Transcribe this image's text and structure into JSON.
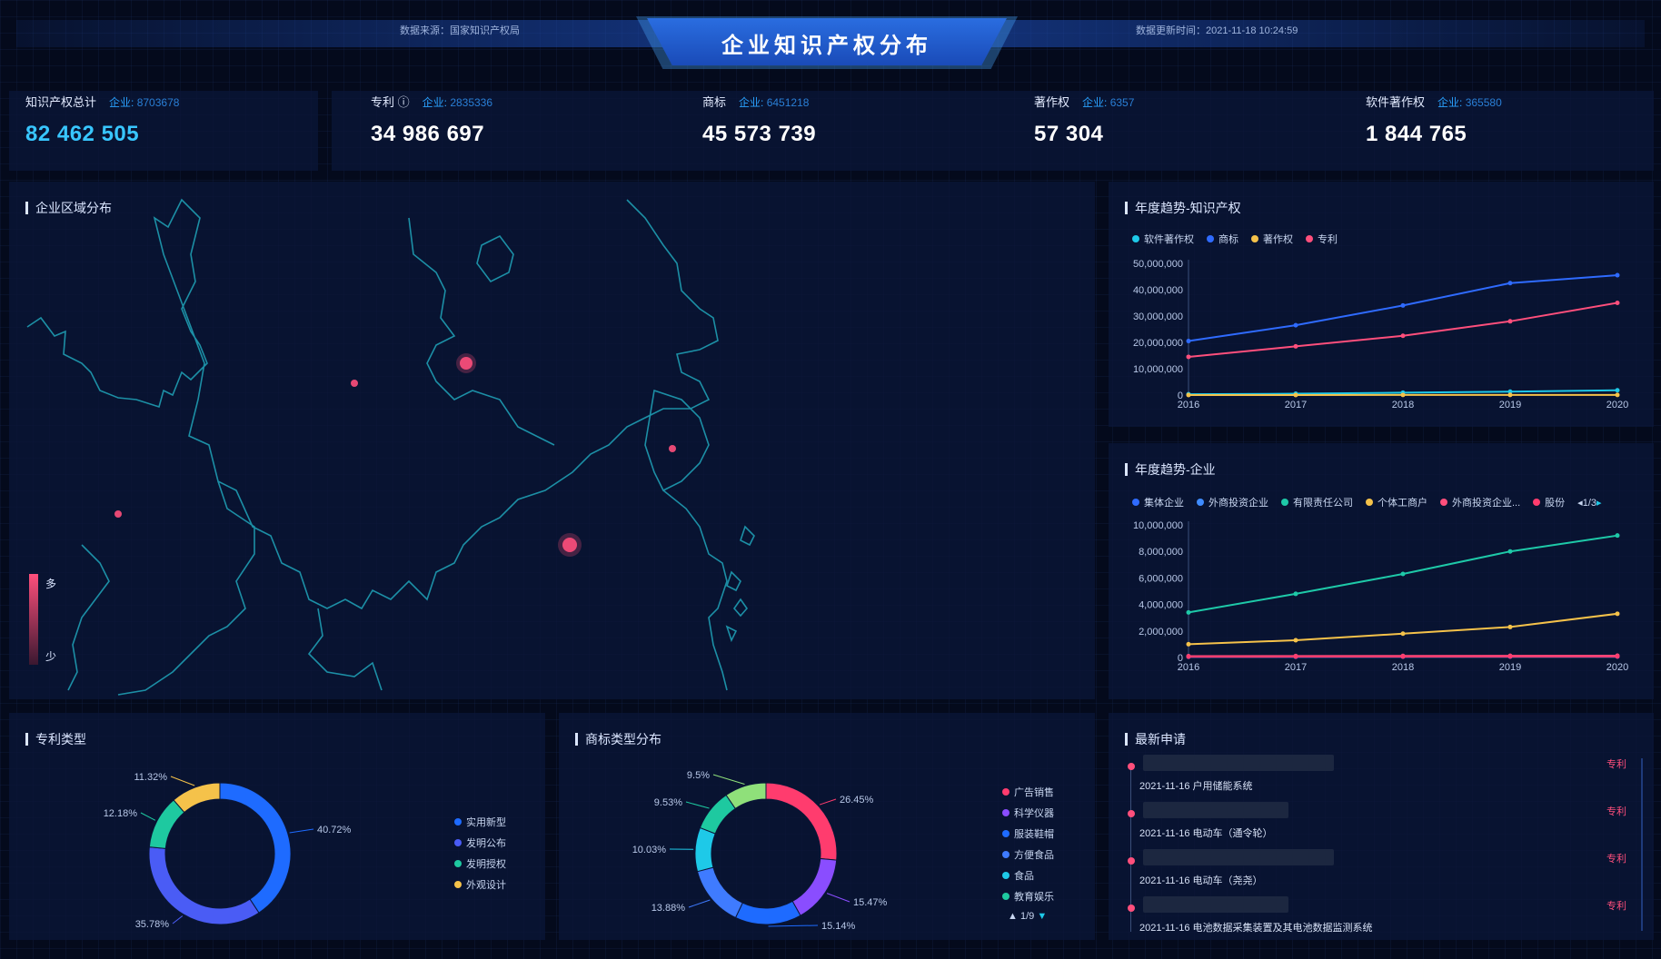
{
  "header": {
    "title": "企业知识产权分布",
    "source": "数据来源：国家知识产权局",
    "update_time": "数据更新时间：2021-11-18 10:24:59"
  },
  "stats": [
    {
      "label": "知识产权总计",
      "company_label": "企业:",
      "company_value": "8703678",
      "value": "82 462 505",
      "color": "#38c6ff"
    },
    {
      "label": "专利 ⓘ",
      "company_label": "企业:",
      "company_value": "2835336",
      "value": "34 986 697",
      "color": "#ffffff"
    },
    {
      "label": "商标",
      "company_label": "企业:",
      "company_value": "6451218",
      "value": "45 573 739",
      "color": "#ffffff"
    },
    {
      "label": "著作权",
      "company_label": "企业:",
      "company_value": "6357",
      "value": "57 304",
      "color": "#ffffff"
    },
    {
      "label": "软件著作权",
      "company_label": "企业:",
      "company_value": "365580",
      "value": "1 844 765",
      "color": "#ffffff"
    }
  ],
  "map_panel": {
    "title": "企业区域分布",
    "scale_high": "多",
    "scale_low": "少"
  },
  "chart_data": [
    {
      "type": "line",
      "title": "年度趋势-知识产权",
      "x": [
        "2016",
        "2017",
        "2018",
        "2019",
        "2020"
      ],
      "ylim": [
        0,
        50000000
      ],
      "yticks": [
        "0",
        "10,000,000",
        "20,000,000",
        "30,000,000",
        "40,000,000",
        "50,000,000"
      ],
      "series": [
        {
          "name": "软件著作权",
          "color": "#1ec9e8",
          "values": [
            300000,
            500000,
            900000,
            1300000,
            1800000
          ]
        },
        {
          "name": "商标",
          "color": "#2f6bff",
          "values": [
            20500000,
            26500000,
            34000000,
            42500000,
            45500000
          ]
        },
        {
          "name": "著作权",
          "color": "#f5c24a",
          "values": [
            10000,
            20000,
            30000,
            45000,
            57000
          ]
        },
        {
          "name": "专利",
          "color": "#ff4f7c",
          "values": [
            14500000,
            18500000,
            22500000,
            28000000,
            35000000
          ]
        }
      ]
    },
    {
      "type": "line",
      "title": "年度趋势-企业",
      "x": [
        "2016",
        "2017",
        "2018",
        "2019",
        "2020"
      ],
      "ylim": [
        0,
        10000000
      ],
      "yticks": [
        "0",
        "2,000,000",
        "4,000,000",
        "6,000,000",
        "8,000,000",
        "10,000,000"
      ],
      "pager": "1/3",
      "series": [
        {
          "name": "集体企业",
          "color": "#2f6bff",
          "values": [
            50000,
            55000,
            60000,
            65000,
            70000
          ]
        },
        {
          "name": "外商投资企业",
          "color": "#3f8cff",
          "values": [
            80000,
            85000,
            90000,
            95000,
            100000
          ]
        },
        {
          "name": "有限责任公司",
          "color": "#1ec9a8",
          "values": [
            3400000,
            4800000,
            6300000,
            8000000,
            9200000
          ]
        },
        {
          "name": "个体工商户",
          "color": "#f5c24a",
          "values": [
            1000000,
            1300000,
            1800000,
            2300000,
            3300000
          ]
        },
        {
          "name": "外商投资企业...",
          "color": "#ff4f7c",
          "values": [
            100000,
            110000,
            120000,
            130000,
            140000
          ]
        },
        {
          "name": "股份",
          "color": "#ff3c6e",
          "values": [
            60000,
            65000,
            70000,
            75000,
            80000
          ]
        }
      ]
    },
    {
      "type": "pie",
      "title": "专利类型",
      "slices": [
        {
          "name": "实用新型",
          "value": 40.72,
          "label": "40.72%",
          "color": "#1e6bff"
        },
        {
          "name": "发明公布",
          "value": 35.78,
          "label": "35.78%",
          "color": "#4a5cf5"
        },
        {
          "name": "发明授权",
          "value": 12.18,
          "label": "12.18%",
          "color": "#1ec9a0"
        },
        {
          "name": "外观设计",
          "value": 11.32,
          "label": "11.32%",
          "color": "#f5c24a"
        }
      ]
    },
    {
      "type": "pie",
      "title": "商标类型分布",
      "pager": "1/9",
      "slices": [
        {
          "name": "广告销售",
          "value": 26.45,
          "label": "26.45%",
          "color": "#ff3c6e"
        },
        {
          "name": "科学仪器",
          "value": 15.47,
          "label": "15.47%",
          "color": "#8a4dff"
        },
        {
          "name": "服装鞋帽",
          "value": 15.14,
          "label": "15.14%",
          "color": "#1e6bff"
        },
        {
          "name": "方便食品",
          "value": 13.88,
          "label": "13.88%",
          "color": "#3f7bff"
        },
        {
          "name": "食品",
          "value": 10.03,
          "label": "10.03%",
          "color": "#1ec9e8"
        },
        {
          "name": "教育娱乐",
          "value": 9.53,
          "label": "9.53%",
          "color": "#1ec9a0"
        },
        {
          "name": "",
          "value": 9.5,
          "label": "9.5%",
          "color": "#8fe07a"
        }
      ]
    }
  ],
  "recent": {
    "title": "最新申请",
    "items": [
      {
        "text": "2021-11-16 户用储能系统",
        "tag": "专利"
      },
      {
        "text": "2021-11-16 电动车（通令轮）",
        "tag": "专利"
      },
      {
        "text": "2021-11-16 电动车（尧尧）",
        "tag": "专利"
      },
      {
        "text": "2021-11-16 电池数据采集装置及其电池数据监测系统",
        "tag": "专利"
      }
    ]
  }
}
